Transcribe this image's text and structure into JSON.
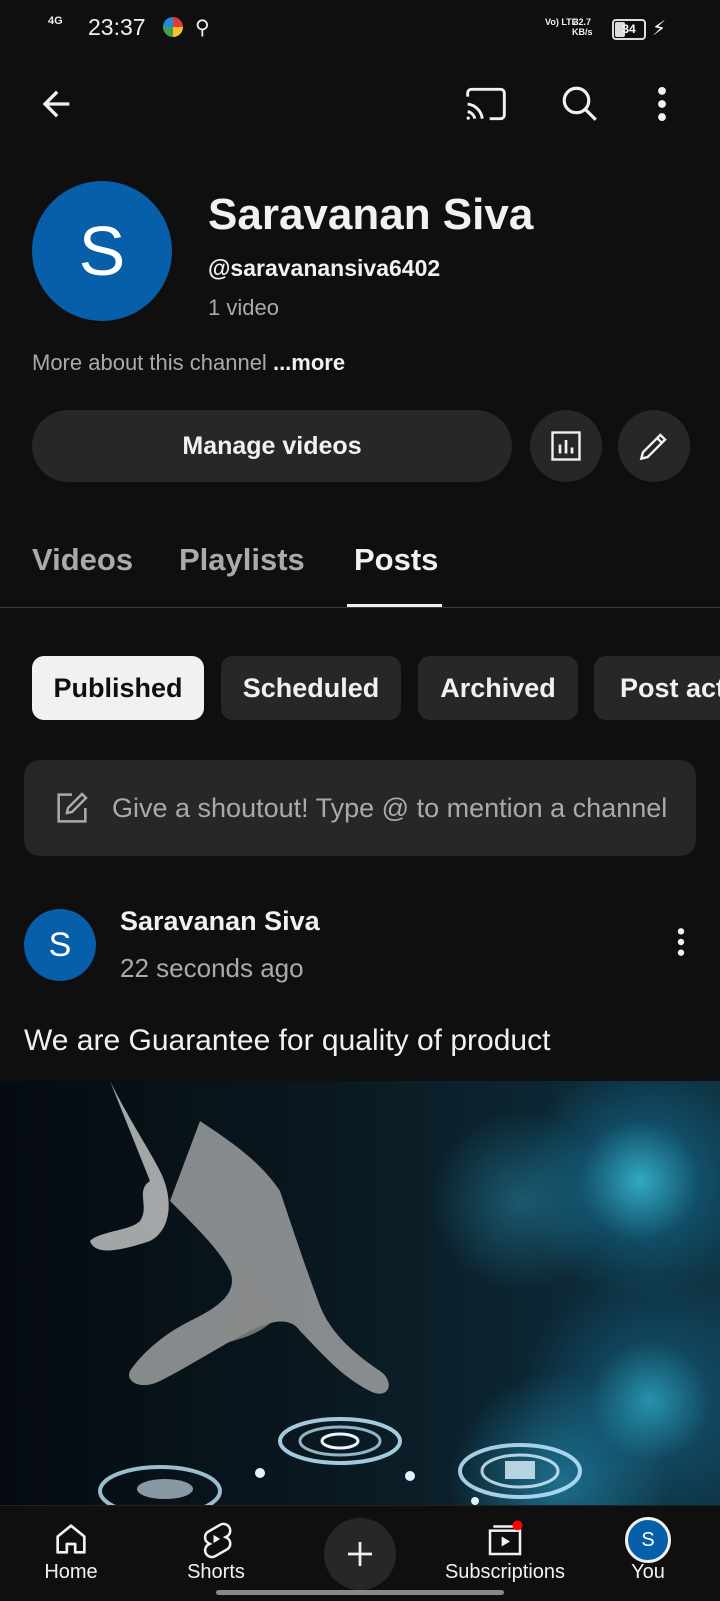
{
  "status_bar": {
    "network": "4G",
    "time": "23:37",
    "volte": "Vo) LTE",
    "speed_value": "32.7",
    "speed_unit": "KB/s",
    "battery": "34"
  },
  "toolbar": {
    "back_icon": "back-arrow-icon",
    "cast_icon": "cast-icon",
    "search_icon": "search-icon",
    "menu_icon": "more-vertical-icon"
  },
  "channel": {
    "avatar_letter": "S",
    "name": "Saravanan Siva",
    "handle": "@saravanansiva6402",
    "video_count": "1 video",
    "about_text": "More about this channel",
    "about_more": "...more",
    "manage_label": "Manage videos"
  },
  "tabs": [
    {
      "label": "Videos",
      "active": false
    },
    {
      "label": "Playlists",
      "active": false
    },
    {
      "label": "Posts",
      "active": true
    }
  ],
  "chips": [
    {
      "label": "Published",
      "active": true
    },
    {
      "label": "Scheduled",
      "active": false
    },
    {
      "label": "Archived",
      "active": false
    },
    {
      "label": "Post act",
      "active": false
    }
  ],
  "shoutout": {
    "placeholder": "Give a shoutout! Type @ to mention a channel"
  },
  "post": {
    "avatar_letter": "S",
    "author": "Saravanan Siva",
    "time": "22 seconds ago",
    "text": "We are Guarantee for quality of product"
  },
  "bottom_nav": [
    {
      "label": "Home",
      "icon": "home-icon"
    },
    {
      "label": "Shorts",
      "icon": "shorts-icon"
    },
    {
      "label": "",
      "icon": "create-icon"
    },
    {
      "label": "Subscriptions",
      "icon": "subscriptions-icon"
    },
    {
      "label": "You",
      "icon": "avatar"
    }
  ],
  "colors": {
    "background": "#0f0f0f",
    "surface": "#272727",
    "avatar_blue": "#065fa8",
    "notification_dot": "#ff0000"
  }
}
